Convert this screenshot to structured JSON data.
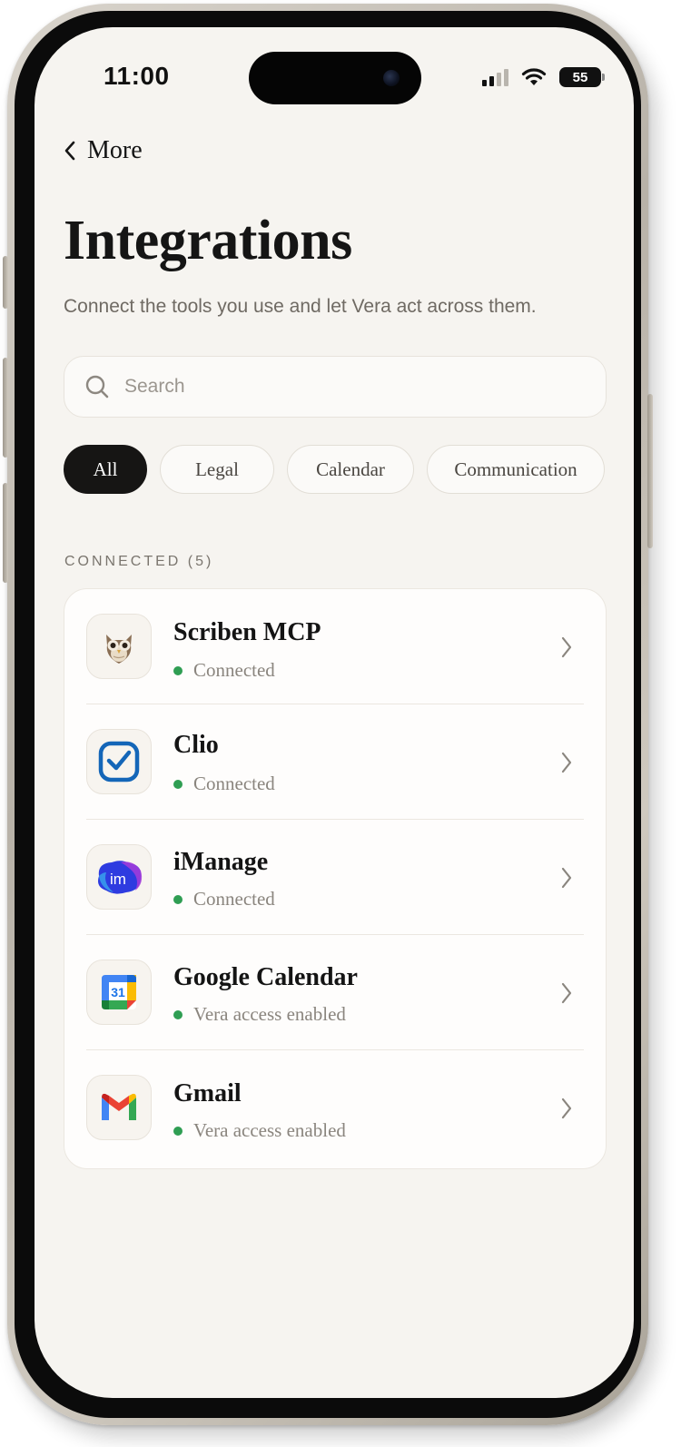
{
  "status_bar": {
    "time": "11:00",
    "battery": "55"
  },
  "nav": {
    "back_label": "More"
  },
  "header": {
    "title": "Integrations",
    "subtitle": "Connect the tools you use and let Vera act across them."
  },
  "search": {
    "placeholder": "Search",
    "value": ""
  },
  "filters": [
    "All",
    "Legal",
    "Calendar",
    "Communication"
  ],
  "active_filter": "All",
  "section": {
    "label": "CONNECTED (5)"
  },
  "integrations": [
    {
      "name": "Scriben MCP",
      "status": "Connected",
      "icon": "owl-icon"
    },
    {
      "name": "Clio",
      "status": "Connected",
      "icon": "clio-icon"
    },
    {
      "name": "iManage",
      "status": "Connected",
      "icon": "imanage-icon"
    },
    {
      "name": "Google Calendar",
      "status": "Vera access enabled",
      "icon": "google-calendar-icon"
    },
    {
      "name": "Gmail",
      "status": "Vera access enabled",
      "icon": "gmail-icon"
    }
  ],
  "colors": {
    "accent": "#161514",
    "status_dot": "#2f9e53",
    "background": "#f6f4f0"
  }
}
